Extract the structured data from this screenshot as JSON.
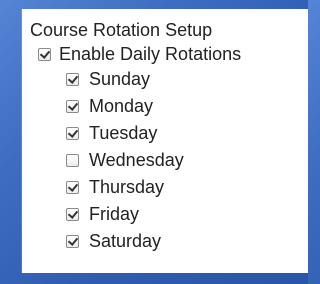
{
  "panel": {
    "title": "Course Rotation Setup",
    "enable": {
      "label": "Enable Daily Rotations",
      "checked": true
    },
    "days": [
      {
        "label": "Sunday",
        "checked": true
      },
      {
        "label": "Monday",
        "checked": true
      },
      {
        "label": "Tuesday",
        "checked": true
      },
      {
        "label": "Wednesday",
        "checked": false
      },
      {
        "label": "Thursday",
        "checked": true
      },
      {
        "label": "Friday",
        "checked": true
      },
      {
        "label": "Saturday",
        "checked": true
      }
    ]
  }
}
